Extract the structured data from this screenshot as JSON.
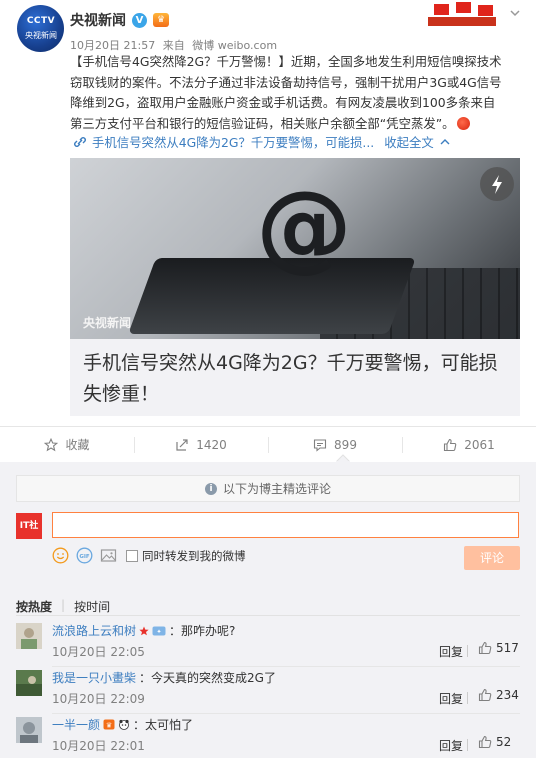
{
  "post": {
    "author": "央视新闻",
    "avatar_text_1": "CCTV",
    "avatar_text_2": "央视新闻",
    "time": "10月20日 21:57",
    "source_prefix": "来自",
    "source": "微博 weibo.com",
    "body": "【手机信号4G突然降2G？千万警惕！】近期，全国多地发生利用短信嗅探技术\n窃取钱财的案件。不法分子通过非法设备劫持信号，强制干扰用户3G或4G信号\n降维到2G，盗取用户金融账户资金或手机话费。有网友凌晨收到100多条来自\n第三方支付平台和银行的短信验证码，相关账户余额全部“凭空蒸发”。",
    "link_text": "手机信号突然从4G降为2G？千万要警惕，可能损...",
    "collapse_label": "收起全文",
    "card": {
      "watermark": "央视新闻",
      "image_mark": "@",
      "title": "手机信号突然从4G降为2G？千万要警惕，可能损失惨重！"
    }
  },
  "actions": {
    "favorite": "收藏",
    "repost_count": "1420",
    "comment_count": "899",
    "like_count": "2061"
  },
  "comment_box": {
    "notice": "以下为博主精选评论",
    "my_avatar": "IT社",
    "input_value": "",
    "input_placeholder": "",
    "repost_label": "同时转发到我的微博",
    "submit_label": "评论"
  },
  "sort": {
    "hot": "按热度",
    "time": "按时间"
  },
  "comments": [
    {
      "user": "流浪路上云和树",
      "text": "：那咋办呢?",
      "time": "10月20日 22:05",
      "reply": "回复",
      "likes": "517"
    },
    {
      "user": "我是一只小畫柴",
      "text": "：今天真的突然变成2G了",
      "time": "10月20日 22:09",
      "reply": "回复",
      "likes": "234"
    },
    {
      "user": "一半一颜",
      "text": "：太可怕了",
      "time": "10月20日 22:01",
      "reply": "回复",
      "likes": "52"
    }
  ],
  "colors": {
    "link": "#3d7ec0",
    "accent": "#ff8140",
    "submit_disabled": "#ffc09f"
  }
}
